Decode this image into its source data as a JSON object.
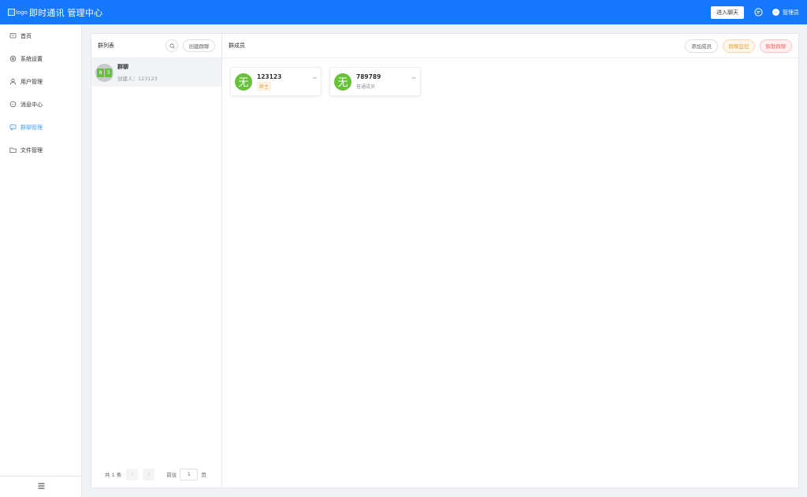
{
  "header": {
    "logo_alt": "logo",
    "title": "即时通讯 管理中心",
    "enter_chat": "进入聊天",
    "admin_label": "管理员"
  },
  "sidebar": {
    "items": [
      {
        "label": "首页",
        "icon": "home-icon"
      },
      {
        "label": "系统设置",
        "icon": "gear-icon"
      },
      {
        "label": "用户管理",
        "icon": "user-icon"
      },
      {
        "label": "消息中心",
        "icon": "chat-bubble-icon"
      },
      {
        "label": "群聊管理",
        "icon": "group-chat-icon",
        "active": true
      },
      {
        "label": "文件管理",
        "icon": "folder-icon"
      }
    ]
  },
  "groups": {
    "title": "群列表",
    "create_label": "创建群聊",
    "items": [
      {
        "name": "群聊",
        "creator": "创建人：123123",
        "avatar_chars": [
          "8",
          "3"
        ]
      }
    ],
    "pager": {
      "total": "共 1 条",
      "prev": "‹",
      "next": "›",
      "goto_prefix": "前往",
      "page": "1",
      "goto_suffix": "页"
    }
  },
  "members": {
    "title": "群成员",
    "add_label": "添加成员",
    "monitor_label": "群聊监控",
    "dissolve_label": "解散群聊",
    "items": [
      {
        "avatar": "无",
        "name": "123123",
        "role": "群主"
      },
      {
        "avatar": "无",
        "name": "789789",
        "role": "普通成员"
      }
    ],
    "more": "···"
  },
  "colors": {
    "primary": "#1677ff",
    "active_menu": "#409eff",
    "avatar_green": "#67c23a",
    "warning": "#e6a23c",
    "danger": "#f56c6c"
  }
}
